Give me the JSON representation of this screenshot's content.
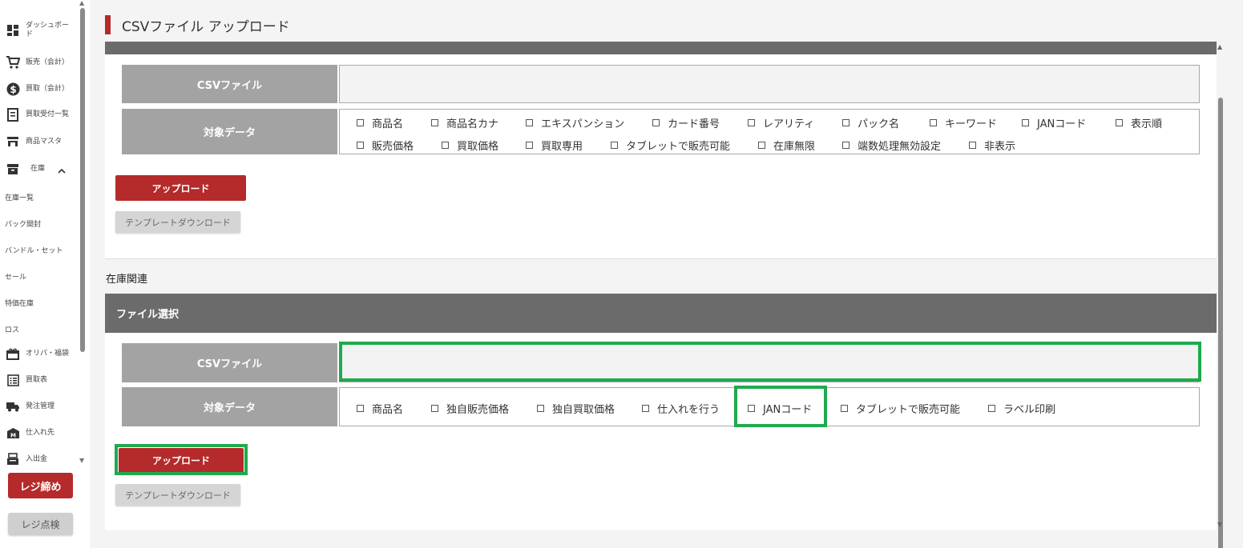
{
  "sidebar": {
    "items": [
      {
        "label": "ダッシュボード",
        "icon": "dashboard-icon"
      },
      {
        "label": "販売（会計）",
        "icon": "cart-icon"
      },
      {
        "label": "買取（会計）",
        "icon": "dollar-icon"
      },
      {
        "label": "買取受付一覧",
        "icon": "receipt-icon"
      },
      {
        "label": "商品マスタ",
        "icon": "store-icon"
      },
      {
        "label": "在庫",
        "icon": "archive-icon"
      }
    ],
    "subitems": [
      "在庫一覧",
      "パック開封",
      "バンドル・セット",
      "セール",
      "特価在庫",
      "ロス"
    ],
    "items2": [
      {
        "label": "オリパ・福袋",
        "icon": "gift-icon"
      },
      {
        "label": "買取表",
        "icon": "list-icon"
      },
      {
        "label": "発注管理",
        "icon": "truck-icon"
      },
      {
        "label": "仕入れ先",
        "icon": "warehouse-icon"
      },
      {
        "label": "入出金",
        "icon": "register-icon"
      }
    ],
    "register_close": "レジ締め",
    "register_check": "レジ点検"
  },
  "page": {
    "title": "CSVファイル アップロード"
  },
  "section1": {
    "csv_label": "CSVファイル",
    "target_label": "対象データ",
    "checkboxes_row1": [
      "商品名",
      "商品名カナ",
      "エキスパンション",
      "カード番号",
      "レアリティ",
      "パック名",
      "キーワード",
      "JANコード",
      "表示順"
    ],
    "checkboxes_row2": [
      "販売価格",
      "買取価格",
      "買取専用",
      "タブレットで販売可能",
      "在庫無限",
      "端数処理無効設定",
      "非表示"
    ],
    "upload_button": "アップロード",
    "template_button": "テンプレートダウンロード"
  },
  "section2": {
    "section_label": "在庫関連",
    "header": "ファイル選択",
    "csv_label": "CSVファイル",
    "target_label": "対象データ",
    "checkboxes": [
      "商品名",
      "独自販売価格",
      "独自買取価格",
      "仕入れを行う",
      "JANコード",
      "タブレットで販売可能",
      "ラベル印刷"
    ],
    "upload_button": "アップロード",
    "template_button": "テンプレートダウンロード"
  },
  "colors": {
    "accent_red": "#b52a2a",
    "header_gray": "#6b6b6b",
    "label_gray": "#a3a3a3",
    "highlight_green": "#1faa4e"
  }
}
